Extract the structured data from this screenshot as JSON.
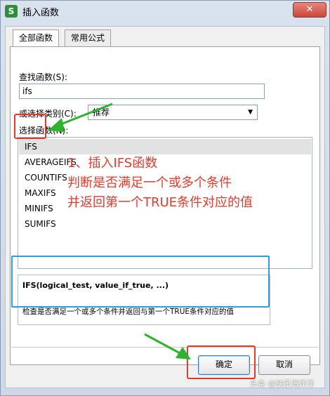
{
  "window": {
    "title": "插入函数",
    "app_icon_letter": "S",
    "close_label": "✕"
  },
  "tabs": [
    {
      "label": "全部函数",
      "active": true
    },
    {
      "label": "常用公式",
      "active": false
    }
  ],
  "search": {
    "label": "查找函数(S):",
    "value": "ifs"
  },
  "category": {
    "label": "或选择类别(C):",
    "selected": "推荐"
  },
  "function_list": {
    "label": "选择函数(N):",
    "items": [
      "IFS",
      "AVERAGEIFS",
      "COUNTIFS",
      "MAXIFS",
      "MINIFS",
      "SUMIFS"
    ],
    "selected": "IFS"
  },
  "description": {
    "signature": "IFS(logical_test, value_if_true, ...)",
    "text": "检查是否满足一个或多个条件并返回与第一个TRUE条件对应的值"
  },
  "buttons": {
    "ok": "确定",
    "cancel": "取消"
  },
  "annotation": {
    "line1": "1、插入IFS函数",
    "line2": "判断是否满足一个或多个条件",
    "line3": "并返回第一个TRUE条件对应的值"
  },
  "watermark": "头条 @快乐海洋洋",
  "colors": {
    "highlight_red": "#e23b2c",
    "highlight_blue": "#2f9be0",
    "arrow_green": "#2db32d"
  }
}
